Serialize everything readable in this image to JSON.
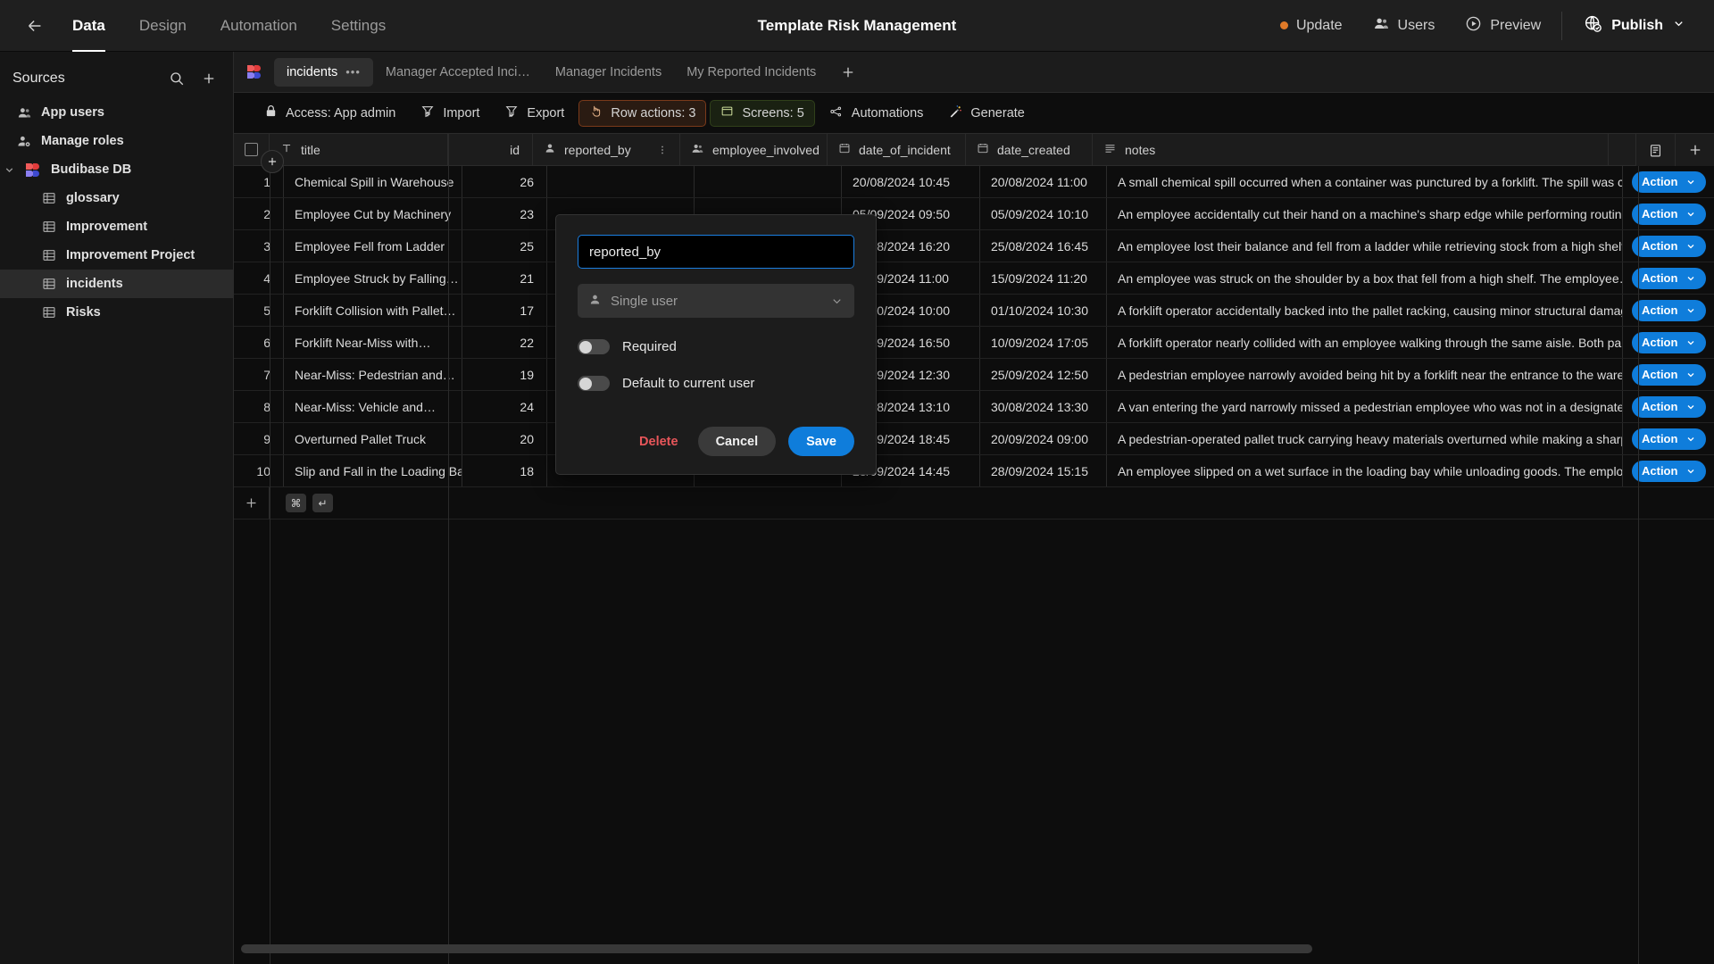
{
  "topbar": {
    "back_icon": "arrow-left-icon",
    "nav": [
      {
        "label": "Data",
        "active": true
      },
      {
        "label": "Design",
        "active": false
      },
      {
        "label": "Automation",
        "active": false
      },
      {
        "label": "Settings",
        "active": false
      }
    ],
    "app_title": "Template Risk Management",
    "update_label": "Update",
    "update_dot_color": "#e07a28",
    "users_label": "Users",
    "preview_label": "Preview",
    "publish_label": "Publish"
  },
  "sidebar": {
    "title": "Sources",
    "search_icon": "search-icon",
    "add_icon": "plus-icon",
    "items": [
      {
        "label": "App users",
        "icon": "users-icon",
        "type": "root"
      },
      {
        "label": "Manage roles",
        "icon": "user-gear-icon",
        "type": "root"
      },
      {
        "label": "Budibase DB",
        "icon": "budibase-logo-icon",
        "type": "db",
        "expanded": true
      },
      {
        "label": "glossary",
        "icon": "table-icon",
        "type": "table"
      },
      {
        "label": "Improvement",
        "icon": "table-icon",
        "type": "table"
      },
      {
        "label": "Improvement Project",
        "icon": "table-icon",
        "type": "table"
      },
      {
        "label": "incidents",
        "icon": "table-icon",
        "type": "table",
        "selected": true
      },
      {
        "label": "Risks",
        "icon": "table-icon",
        "type": "table"
      }
    ]
  },
  "tabs": {
    "logo_icon": "budibase-logo-icon",
    "items": [
      {
        "label": "incidents",
        "active": true,
        "menu": "•••"
      },
      {
        "label": "Manager Accepted Inci…",
        "active": false
      },
      {
        "label": "Manager Incidents",
        "active": false
      },
      {
        "label": "My Reported Incidents",
        "active": false
      }
    ],
    "add_label": "+"
  },
  "toolbar": [
    {
      "label": "Access: App admin",
      "icon": "lock-icon",
      "style": "plain"
    },
    {
      "label": "Import",
      "icon": "import-icon",
      "style": "plain"
    },
    {
      "label": "Export",
      "icon": "export-icon",
      "style": "plain"
    },
    {
      "label": "Row actions: 3",
      "icon": "pointer-icon",
      "style": "orange"
    },
    {
      "label": "Screens: 5",
      "icon": "window-icon",
      "style": "green"
    },
    {
      "label": "Automations",
      "icon": "automation-icon",
      "style": "plain"
    },
    {
      "label": "Generate",
      "icon": "magic-wand-icon",
      "style": "plain"
    }
  ],
  "grid": {
    "select_all_icon": "checkbox-icon",
    "columns": [
      {
        "key": "title",
        "label": "title",
        "icon": "text-icon"
      },
      {
        "key": "id",
        "label": "id",
        "icon": ""
      },
      {
        "key": "reported_by",
        "label": "reported_by",
        "icon": "single-user-icon",
        "menu": true
      },
      {
        "key": "employee_involved",
        "label": "employee_involved",
        "icon": "multi-user-icon"
      },
      {
        "key": "date_of_incident",
        "label": "date_of_incident",
        "icon": "calendar-icon"
      },
      {
        "key": "date_created",
        "label": "date_created",
        "icon": "calendar-icon"
      },
      {
        "key": "notes",
        "label": "notes",
        "icon": "longform-icon"
      }
    ],
    "header_right_icons": [
      "columns-icon",
      "plus-icon"
    ],
    "action_label": "Action",
    "rows": [
      {
        "n": "1",
        "title": "Chemical Spill in Warehouse",
        "id": "26",
        "reported_by": "",
        "employee_involved": "",
        "date_of_incident": "20/08/2024 10:45",
        "date_created": "20/08/2024 11:00",
        "notes": "A small chemical spill occurred when a container was punctured by a forklift. The spill was contain"
      },
      {
        "n": "2",
        "title": "Employee Cut by Machinery",
        "id": "23",
        "reported_by": "",
        "employee_involved": "",
        "date_of_incident": "05/09/2024 09:50",
        "date_created": "05/09/2024 10:10",
        "notes": "An employee accidentally cut their hand on a machine's sharp edge while performing routine…"
      },
      {
        "n": "3",
        "title": "Employee Fell from Ladder",
        "id": "25",
        "reported_by": "",
        "employee_involved": "",
        "date_of_incident": "25/08/2024 16:20",
        "date_created": "25/08/2024 16:45",
        "notes": "An employee lost their balance and fell from a ladder while retrieving stock from a high shelf. The.."
      },
      {
        "n": "4",
        "title": "Employee Struck by Falling…",
        "id": "21",
        "reported_by": "",
        "employee_involved": "",
        "date_of_incident": "15/09/2024 11:00",
        "date_created": "15/09/2024 11:20",
        "notes": "An employee was struck on the shoulder by a box that fell from a high shelf. The employee…"
      },
      {
        "n": "5",
        "title": "Forklift Collision with Pallet…",
        "id": "17",
        "reported_by": "",
        "employee_involved": "",
        "date_of_incident": "01/10/2024 10:00",
        "date_created": "01/10/2024 10:30",
        "notes": "A forklift operator accidentally backed into the pallet racking, causing minor structural damage. No"
      },
      {
        "n": "6",
        "title": "Forklift Near-Miss with…",
        "id": "22",
        "reported_by": "",
        "employee_involved": "",
        "date_of_incident": "10/09/2024 16:50",
        "date_created": "10/09/2024 17:05",
        "notes": "A forklift operator nearly collided with an employee walking through the same aisle. Both parties.."
      },
      {
        "n": "7",
        "title": "Near-Miss: Pedestrian and…",
        "id": "19",
        "reported_by": "",
        "employee_involved": "",
        "date_of_incident": "25/09/2024 12:30",
        "date_created": "25/09/2024 12:50",
        "notes": "A pedestrian employee narrowly avoided being hit by a forklift near the entrance to the warehouse"
      },
      {
        "n": "8",
        "title": "Near-Miss: Vehicle and…",
        "id": "24",
        "reported_by": "",
        "employee_involved": "",
        "date_of_incident": "30/08/2024 13:10",
        "date_created": "30/08/2024 13:30",
        "notes": "A van entering the yard narrowly missed a pedestrian employee who was not in a designated…"
      },
      {
        "n": "9",
        "title": "Overturned Pallet Truck",
        "id": "20",
        "reported_by": "",
        "employee_involved": "",
        "date_of_incident": "19/09/2024 18:45",
        "date_created": "20/09/2024 09:00",
        "notes": "A pedestrian-operated pallet truck carrying heavy materials overturned while making a sharp turn"
      },
      {
        "n": "10",
        "title": "Slip and Fall in the Loading Bay",
        "id": "18",
        "reported_by": "",
        "employee_involved": "",
        "date_of_incident": "28/09/2024 14:45",
        "date_created": "28/09/2024 15:15",
        "notes": "An employee slipped on a wet surface in the loading bay while unloading goods. The employee…"
      }
    ],
    "add_row_icon": "plus-icon",
    "keycaps": [
      "⌘",
      "↵"
    ]
  },
  "modal": {
    "name_value": "reported_by",
    "type_value": "Single user",
    "type_icon": "single-user-icon",
    "required_label": "Required",
    "required_on": false,
    "default_user_label": "Default to current user",
    "default_user_on": false,
    "delete_label": "Delete",
    "cancel_label": "Cancel",
    "save_label": "Save",
    "accent_color": "#0f7ddb",
    "delete_color": "#e8565a"
  }
}
